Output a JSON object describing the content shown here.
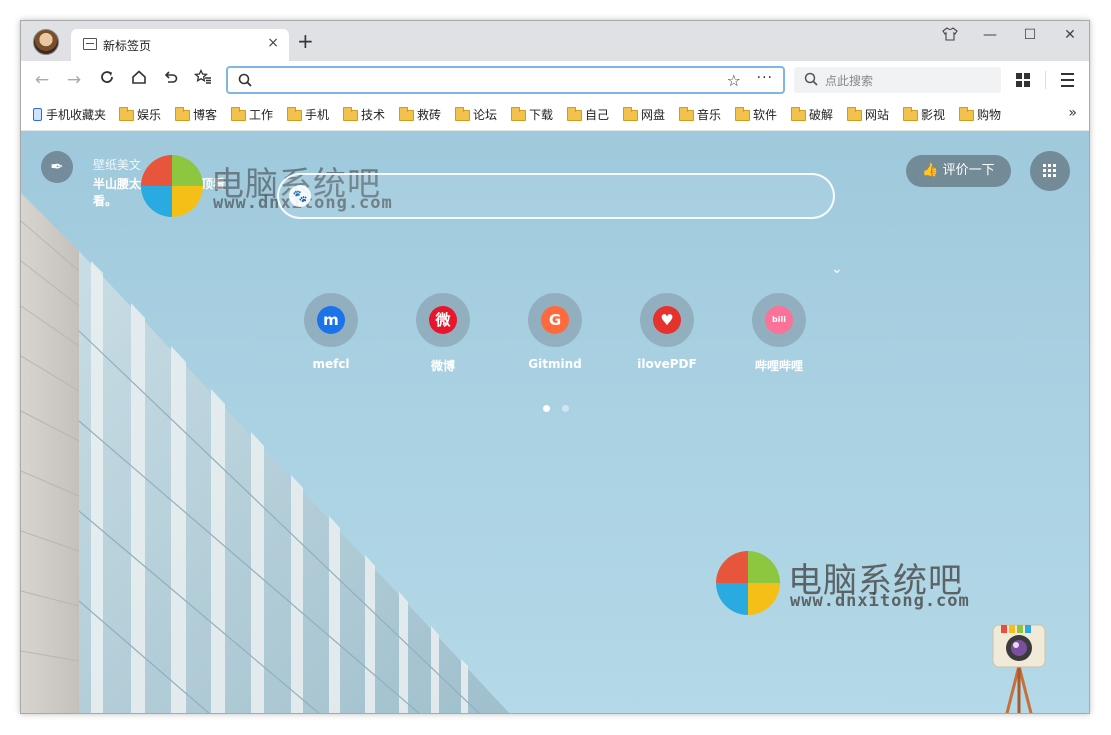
{
  "tab": {
    "title": "新标签页",
    "close": "×",
    "new_tab": "+"
  },
  "window_controls": {
    "skin": "👕",
    "minimize": "—",
    "maximize": "☐",
    "close": "✕"
  },
  "toolbar": {
    "back": "←",
    "forward": "→",
    "reload": "C",
    "home": "⌂",
    "undo": "↶",
    "favorites": "☆≡",
    "address_value": "",
    "address_star": "☆",
    "address_more": "···",
    "search_placeholder": "点此搜索"
  },
  "bookmarks": [
    {
      "label": "手机收藏夹",
      "type": "phone"
    },
    {
      "label": "娱乐",
      "type": "folder"
    },
    {
      "label": "博客",
      "type": "folder"
    },
    {
      "label": "工作",
      "type": "folder"
    },
    {
      "label": "手机",
      "type": "folder"
    },
    {
      "label": "技术",
      "type": "folder"
    },
    {
      "label": "救砖",
      "type": "folder"
    },
    {
      "label": "论坛",
      "type": "folder"
    },
    {
      "label": "下载",
      "type": "folder"
    },
    {
      "label": "自己",
      "type": "folder"
    },
    {
      "label": "网盘",
      "type": "folder"
    },
    {
      "label": "音乐",
      "type": "folder"
    },
    {
      "label": "软件",
      "type": "folder"
    },
    {
      "label": "破解",
      "type": "folder"
    },
    {
      "label": "网站",
      "type": "folder"
    },
    {
      "label": "影视",
      "type": "folder"
    },
    {
      "label": "购物",
      "type": "folder"
    }
  ],
  "bookmarks_more": "»",
  "newtab": {
    "wallpaper_title": "壁纸美文",
    "wallpaper_text": "半山腰太挤了，去山顶看看。",
    "rate_label": "评价一下",
    "watermark_name": "电脑系统吧",
    "watermark_url": "www.dnxitong.com",
    "sites": [
      {
        "label": "mefcl",
        "glyph": "m",
        "color": "#1a73e8"
      },
      {
        "label": "微博",
        "glyph": "微",
        "color": "#e6162d"
      },
      {
        "label": "Gitmind",
        "glyph": "G",
        "color": "#ff6a3d"
      },
      {
        "label": "ilovePDF",
        "glyph": "♥",
        "color": "#e5322d"
      },
      {
        "label": "哔哩哔哩",
        "glyph": "bili",
        "color": "#fb7299"
      }
    ],
    "page_dots": 2,
    "active_dot": 0
  }
}
